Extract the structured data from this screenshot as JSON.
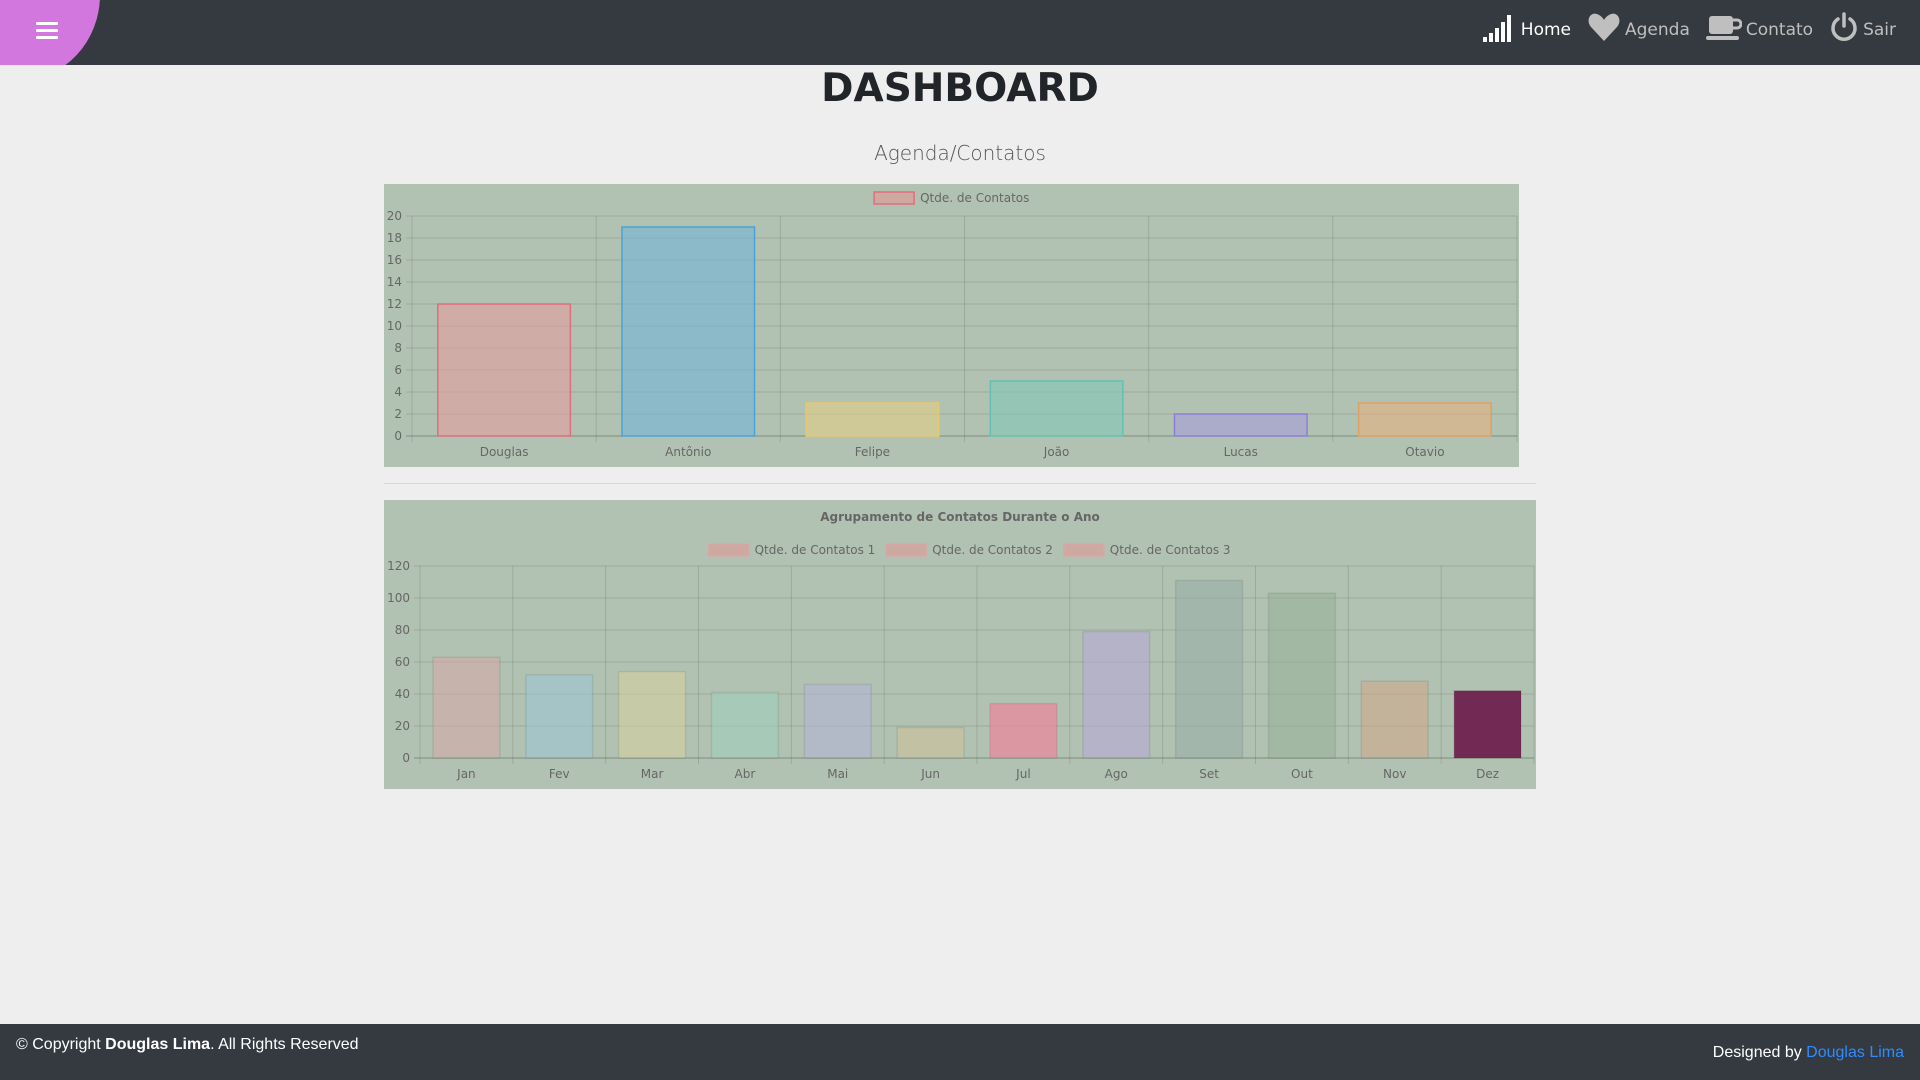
{
  "header": {
    "menu_icon": "hamburger-icon",
    "nav": [
      {
        "label": "Home",
        "icon": "signal-bars-icon",
        "active": true
      },
      {
        "label": "Agenda",
        "icon": "heart-icon",
        "active": false
      },
      {
        "label": "Contato",
        "icon": "coffee-cup-icon",
        "active": false
      },
      {
        "label": "Sair",
        "icon": "power-icon",
        "active": false
      }
    ],
    "accent_color": "#d277dd",
    "bar_color": "#343a40"
  },
  "main": {
    "title": "DASHBOARD",
    "subtitle": "Agenda/Contatos"
  },
  "chart_data": [
    {
      "type": "bar",
      "title": "",
      "legend": [
        "Qtde. de Contatos"
      ],
      "legend_position": "top",
      "categories": [
        "Douglas",
        "Antônio",
        "Felipe",
        "João",
        "Lucas",
        "Otavio"
      ],
      "series": [
        {
          "name": "Qtde. de Contatos",
          "values": [
            12,
            19,
            3,
            5,
            2,
            3
          ]
        }
      ],
      "colors": [
        "#e89a9a",
        "#6fb4dc",
        "#e8cf84",
        "#7cc8b8",
        "#a59ade",
        "#e8b07a"
      ],
      "border_colors": [
        "#e06d7e",
        "#4aa3d8",
        "#e6c870",
        "#61c2b2",
        "#8c7ed6",
        "#e0a060"
      ],
      "ylim": [
        0,
        20
      ],
      "yticks": [
        0,
        2,
        4,
        6,
        8,
        10,
        12,
        14,
        16,
        18,
        20
      ],
      "grid": true
    },
    {
      "type": "bar",
      "title": "Agrupamento de Contatos Durante o Ano",
      "legend": [
        "Qtde. de Contatos 1",
        "Qtde. de Contatos 2",
        "Qtde. de Contatos 3"
      ],
      "legend_position": "top",
      "categories": [
        "Jan",
        "Fev",
        "Mar",
        "Abr",
        "Mai",
        "Jun",
        "Jul",
        "Ago",
        "Set",
        "Out",
        "Nov",
        "Dez"
      ],
      "series": [
        {
          "name": "Qtde. de Contatos 1",
          "values": [
            63,
            52,
            54,
            41,
            46,
            19,
            34,
            79,
            111,
            103,
            48,
            42
          ]
        }
      ],
      "colors": [
        "#d4a9a9",
        "#9bc4d4",
        "#d6cfa0",
        "#9fcdbc",
        "#b3b3d6",
        "#cfc09a",
        "#e88a9c",
        "#b6a9d6",
        "#98ada8",
        "#98b09a",
        "#cfa98a",
        "#722a55"
      ],
      "ylim": [
        0,
        120
      ],
      "yticks": [
        0,
        20,
        40,
        60,
        80,
        100,
        120
      ],
      "grid": true
    }
  ],
  "footer": {
    "copyright_prefix": "© Copyright ",
    "owner": "Douglas Lima",
    "rights": ". All Rights Reserved",
    "designed_by": "Designed by ",
    "designer": "Douglas Lima",
    "link_color": "#2f8cff"
  }
}
